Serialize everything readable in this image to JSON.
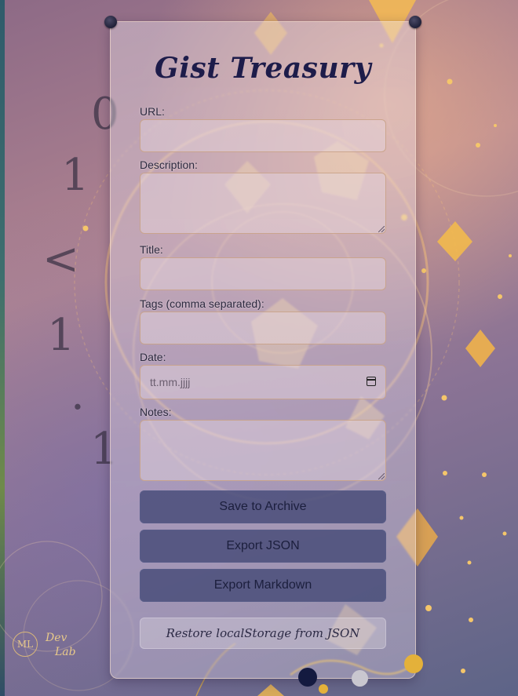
{
  "app": {
    "title": "Gist Treasury"
  },
  "form": {
    "url_label": "URL:",
    "url_value": "",
    "description_label": "Description:",
    "description_value": "",
    "title_label": "Title:",
    "title_value": "",
    "tags_label": "Tags (comma separated):",
    "tags_value": "",
    "date_label": "Date:",
    "date_placeholder": "tt.mm.jjjj",
    "notes_label": "Notes:",
    "notes_value": ""
  },
  "buttons": {
    "save": "Save to Archive",
    "export_json": "Export JSON",
    "export_markdown": "Export Markdown",
    "restore": "Restore localStorage from JSON"
  },
  "branding": {
    "logo_initials": "ML",
    "logo_text_1": "Dev",
    "logo_text_2": "Lab"
  },
  "background_digits": [
    "0",
    "1",
    "<",
    "1",
    ".",
    "1"
  ],
  "colors": {
    "title": "#1d1c4a",
    "button_bg": "#464b78",
    "accent_gold": "#e4b13a",
    "dot_navy": "#141a40",
    "dot_grey": "#c9c7cf"
  }
}
